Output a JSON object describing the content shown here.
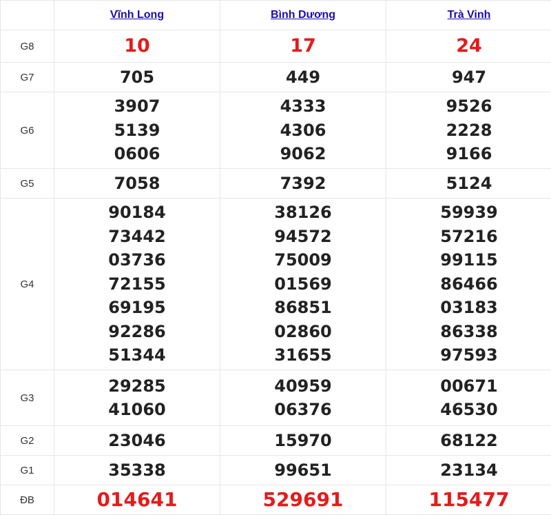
{
  "provinces": [
    "Vĩnh Long",
    "Bình Dương",
    "Trà Vinh"
  ],
  "rows": [
    {
      "label": "G8",
      "values": [
        [
          "10"
        ],
        [
          "17"
        ],
        [
          "24"
        ]
      ]
    },
    {
      "label": "G7",
      "values": [
        [
          "705"
        ],
        [
          "449"
        ],
        [
          "947"
        ]
      ]
    },
    {
      "label": "G6",
      "values": [
        [
          "3907",
          "5139",
          "0606"
        ],
        [
          "4333",
          "4306",
          "9062"
        ],
        [
          "9526",
          "2228",
          "9166"
        ]
      ]
    },
    {
      "label": "G5",
      "values": [
        [
          "7058"
        ],
        [
          "7392"
        ],
        [
          "5124"
        ]
      ]
    },
    {
      "label": "G4",
      "values": [
        [
          "90184",
          "73442",
          "03736",
          "72155",
          "69195",
          "92286",
          "51344"
        ],
        [
          "38126",
          "94572",
          "75009",
          "01569",
          "86851",
          "02860",
          "31655"
        ],
        [
          "59939",
          "57216",
          "99115",
          "86466",
          "03183",
          "86338",
          "97593"
        ]
      ]
    },
    {
      "label": "G3",
      "values": [
        [
          "29285",
          "41060"
        ],
        [
          "40959",
          "06376"
        ],
        [
          "00671",
          "46530"
        ]
      ]
    },
    {
      "label": "G2",
      "values": [
        [
          "23046"
        ],
        [
          "15970"
        ],
        [
          "68122"
        ]
      ]
    },
    {
      "label": "G1",
      "values": [
        [
          "35338"
        ],
        [
          "99651"
        ],
        [
          "23134"
        ]
      ]
    },
    {
      "label": "ĐB",
      "values": [
        [
          "014641"
        ],
        [
          "529691"
        ],
        [
          "115477"
        ]
      ]
    }
  ],
  "colors": {
    "highlight": "#e31c1c",
    "link": "#1a0dab",
    "text": "#222222"
  }
}
